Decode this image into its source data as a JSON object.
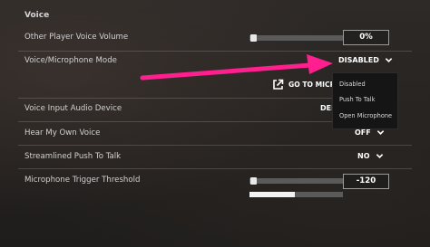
{
  "section_title": "Voice",
  "rows": {
    "other_player_volume": {
      "label": "Other Player Voice Volume",
      "value": "0%",
      "slider_level": 0
    },
    "mic_mode": {
      "label": "Voice/Microphone Mode",
      "value": "DISABLED"
    },
    "input_device": {
      "label": "Voice Input Audio Device",
      "value": "DEFA"
    },
    "hear_own_voice": {
      "label": "Hear My Own Voice",
      "value": "OFF"
    },
    "streamlined_ptt": {
      "label": "Streamlined Push To Talk",
      "value": "NO"
    },
    "trigger_threshold": {
      "label": "Microphone Trigger Threshold",
      "value": "-120",
      "slider_level": 0,
      "meter_level": 0.48
    }
  },
  "mic_link": {
    "label": "GO TO MICROPH",
    "icon": "external-link-icon"
  },
  "dropdown_menu": {
    "options": [
      "Disabled",
      "Push To Talk",
      "Open Microphone"
    ]
  },
  "colors": {
    "annotation_arrow": "#ff1f8e",
    "menu_bg": "#151515"
  }
}
